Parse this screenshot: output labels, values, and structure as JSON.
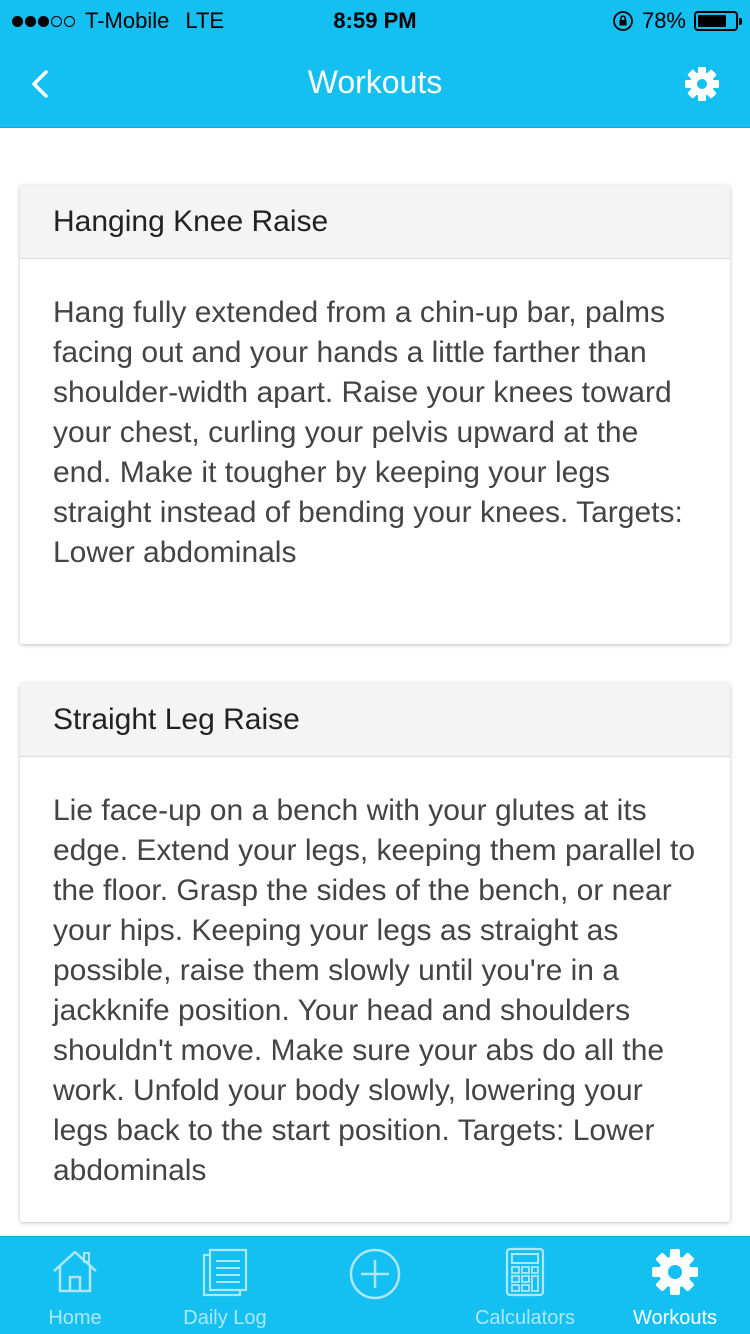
{
  "status_bar": {
    "carrier": "T-Mobile",
    "network": "LTE",
    "time": "8:59 PM",
    "battery": "78%",
    "signal_bars": 3,
    "signal_max": 5,
    "battery_level": 0.78
  },
  "header": {
    "title": "Workouts",
    "back_icon": "chevron-left-icon",
    "settings_icon": "gear-icon"
  },
  "workouts": [
    {
      "title": "Hanging Knee Raise",
      "description": "Hang fully extended from a chin-up bar, palms facing out and your hands a little farther than shoulder-width apart. Raise your knees toward your chest, curling your pelvis upward at the end. Make it tougher by keeping your legs straight instead of bending your knees. Targets: Lower abdominals"
    },
    {
      "title": "Straight Leg Raise",
      "description": "Lie face-up on a bench with your glutes at its edge. Extend your legs, keeping them parallel to the floor. Grasp the sides of the bench, or near your hips. Keeping your legs as straight as possible, raise them slowly until you're in a jackknife position. Your head and shoulders shouldn't move. Make sure your abs do all the work. Unfold your body slowly, lowering your legs back to the start position. Targets: Lower abdominals"
    }
  ],
  "tab_bar": {
    "tabs": [
      {
        "label": "Home",
        "icon": "home-icon"
      },
      {
        "label": "Daily Log",
        "icon": "notepad-icon"
      },
      {
        "label": "",
        "icon": "add-circle-icon"
      },
      {
        "label": "Calculators",
        "icon": "calculator-icon"
      },
      {
        "label": "Workouts",
        "icon": "gear-icon",
        "active": true
      }
    ]
  },
  "colors": {
    "accent": "#14bff1",
    "tab_inactive": "#aee6fa",
    "tab_active": "#ffffff"
  }
}
